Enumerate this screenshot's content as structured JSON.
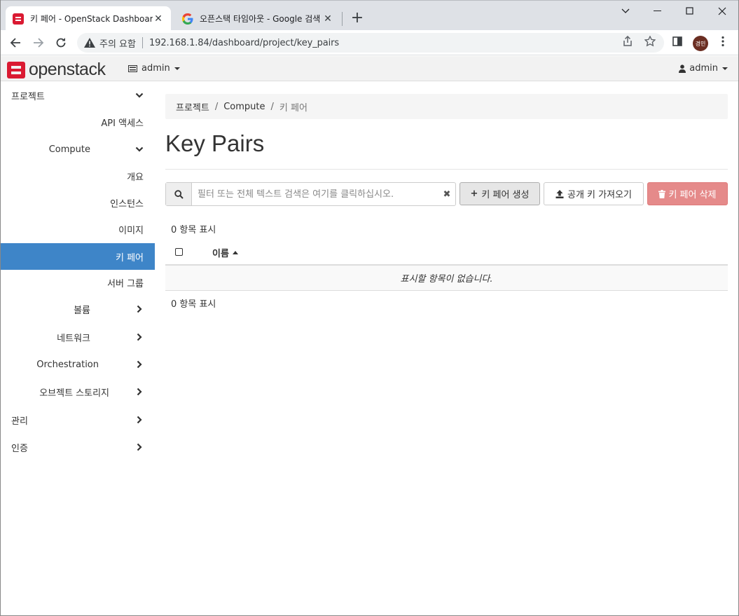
{
  "browser": {
    "tabs": [
      {
        "title": "키 페어 - OpenStack Dashboard",
        "active": true
      },
      {
        "title": "오픈스택 타임아웃 - Google 검색",
        "active": false
      }
    ],
    "new_tab": "+",
    "address": {
      "security_warning": "주의 요함",
      "url": "192.168.1.84/dashboard/project/key_pairs"
    },
    "profile_initials": "경민"
  },
  "header": {
    "logo_text": "openstack",
    "project_selector": "admin",
    "user_menu": "admin"
  },
  "sidebar": {
    "items": [
      {
        "label": "프로젝트",
        "level": 0,
        "chevron": "down"
      },
      {
        "label": "API 액세스",
        "level": 2
      },
      {
        "label": "Compute",
        "level": 1,
        "chevron": "down"
      },
      {
        "label": "개요",
        "level": 2
      },
      {
        "label": "인스턴스",
        "level": 2
      },
      {
        "label": "이미지",
        "level": 2
      },
      {
        "label": "키 페어",
        "level": 2,
        "active": true
      },
      {
        "label": "서버 그룹",
        "level": 2
      },
      {
        "label": "볼륨",
        "level": 1,
        "chevron": "right"
      },
      {
        "label": "네트워크",
        "level": 1,
        "chevron": "right"
      },
      {
        "label": "Orchestration",
        "level": 1,
        "chevron": "right"
      },
      {
        "label": "오브젝트 스토리지",
        "level": 1,
        "chevron": "right"
      },
      {
        "label": "관리",
        "level": 0,
        "chevron": "right"
      },
      {
        "label": "인증",
        "level": 0,
        "chevron": "right"
      }
    ]
  },
  "breadcrumb": {
    "items": [
      "프로젝트",
      "Compute",
      "키 페어"
    ],
    "separator": "/"
  },
  "page": {
    "title": "Key Pairs"
  },
  "filter": {
    "placeholder": "필터 또는 전체 텍스트 검색은 여기를 클릭하십시오."
  },
  "actions": {
    "create": "키 페어 생성",
    "import": "공개 키 가져오기",
    "delete": "키 페어 삭제"
  },
  "table": {
    "count_top": "0 항목 표시",
    "count_bottom": "0 항목 표시",
    "columns": [
      "이름"
    ],
    "empty_message": "표시할 항목이 없습니다."
  },
  "colors": {
    "accent": "#3e85c8",
    "logo_red": "#da1a32",
    "danger": "#e58a8a"
  }
}
